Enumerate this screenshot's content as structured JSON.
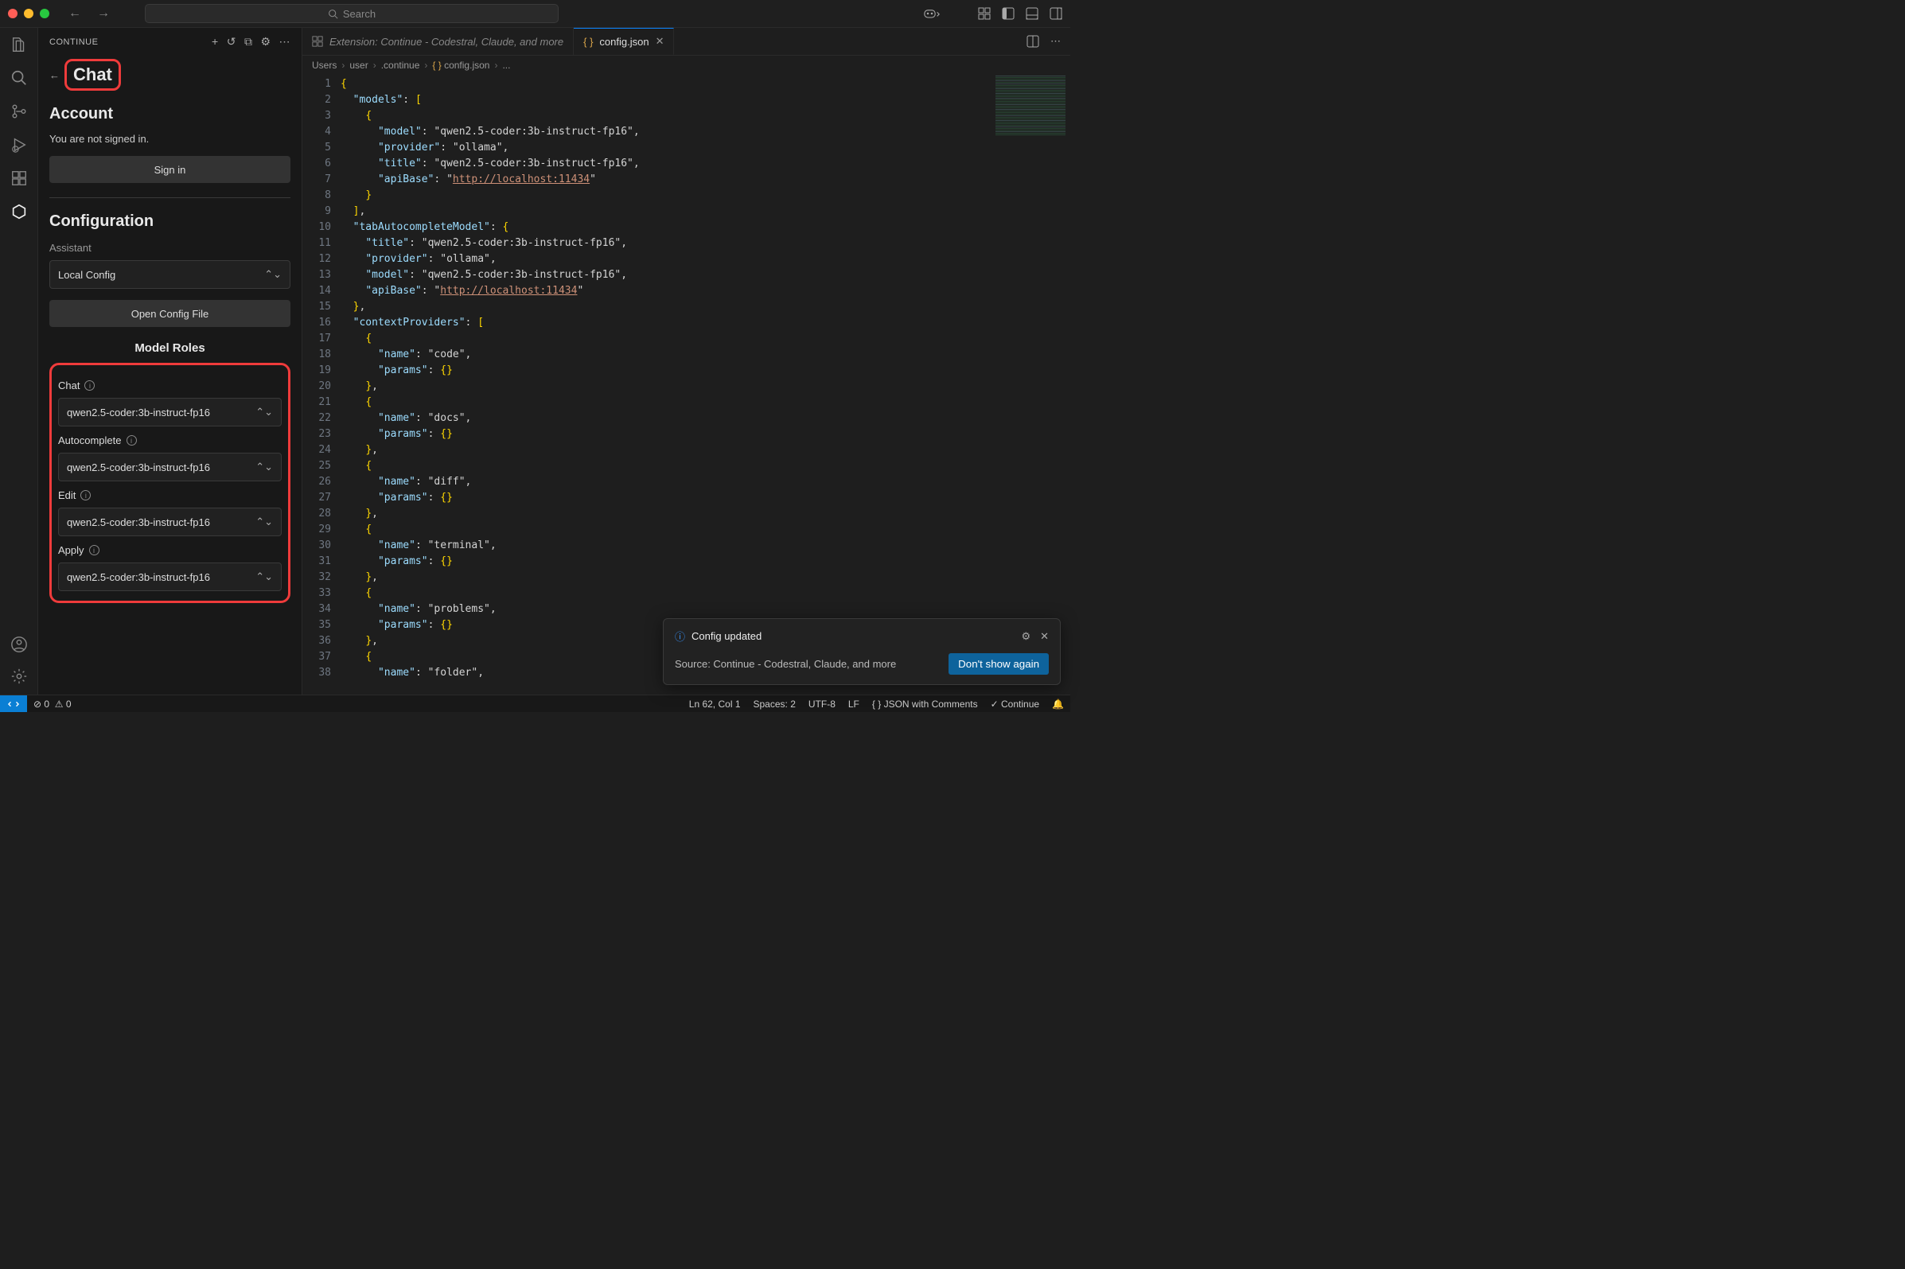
{
  "search_placeholder": "Search",
  "sidebar": {
    "title": "CONTINUE",
    "chat_heading": "Chat",
    "account_heading": "Account",
    "signed_out_text": "You are not signed in.",
    "sign_in_label": "Sign in",
    "config_heading": "Configuration",
    "assistant_label": "Assistant",
    "assistant_value": "Local Config",
    "open_config_label": "Open Config File",
    "model_roles_heading": "Model Roles",
    "roles": [
      {
        "label": "Chat",
        "value": "qwen2.5-coder:3b-instruct-fp16"
      },
      {
        "label": "Autocomplete",
        "value": "qwen2.5-coder:3b-instruct-fp16"
      },
      {
        "label": "Edit",
        "value": "qwen2.5-coder:3b-instruct-fp16"
      },
      {
        "label": "Apply",
        "value": "qwen2.5-coder:3b-instruct-fp16"
      }
    ]
  },
  "tabs": {
    "inactive": "Extension: Continue - Codestral, Claude, and more",
    "active": "config.json"
  },
  "breadcrumb": [
    "Users",
    "user",
    ".continue",
    "config.json",
    "..."
  ],
  "code": {
    "lines": [
      "{",
      "  \"models\": [",
      "    {",
      "      \"model\": \"qwen2.5-coder:3b-instruct-fp16\",",
      "      \"provider\": \"ollama\",",
      "      \"title\": \"qwen2.5-coder:3b-instruct-fp16\",",
      "      \"apiBase\": \"http://localhost:11434\"",
      "    }",
      "  ],",
      "  \"tabAutocompleteModel\": {",
      "    \"title\": \"qwen2.5-coder:3b-instruct-fp16\",",
      "    \"provider\": \"ollama\",",
      "    \"model\": \"qwen2.5-coder:3b-instruct-fp16\",",
      "    \"apiBase\": \"http://localhost:11434\"",
      "  },",
      "  \"contextProviders\": [",
      "    {",
      "      \"name\": \"code\",",
      "      \"params\": {}",
      "    },",
      "    {",
      "      \"name\": \"docs\",",
      "      \"params\": {}",
      "    },",
      "    {",
      "      \"name\": \"diff\",",
      "      \"params\": {}",
      "    },",
      "    {",
      "      \"name\": \"terminal\",",
      "      \"params\": {}",
      "    },",
      "    {",
      "      \"name\": \"problems\",",
      "      \"params\": {}",
      "    },",
      "    {",
      "      \"name\": \"folder\","
    ]
  },
  "notification": {
    "title": "Config updated",
    "source": "Source: Continue - Codestral, Claude, and more",
    "button": "Don't show again"
  },
  "statusbar": {
    "errors": "0",
    "warnings": "0",
    "position": "Ln 62, Col 1",
    "spaces": "Spaces: 2",
    "encoding": "UTF-8",
    "eol": "LF",
    "language": "JSON with Comments",
    "continue": "Continue"
  }
}
